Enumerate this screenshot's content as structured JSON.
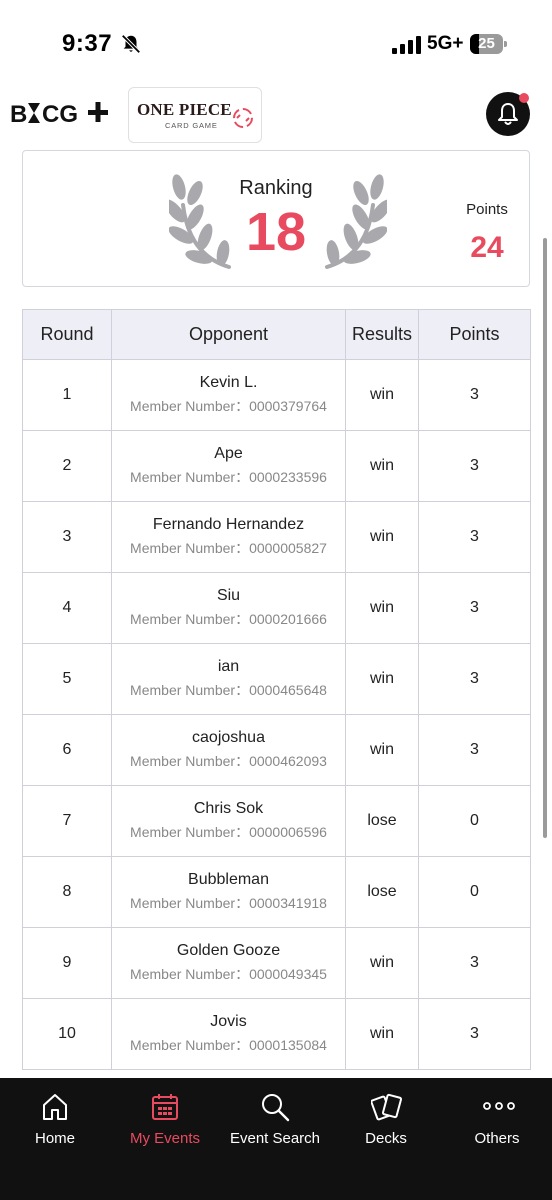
{
  "status_bar": {
    "time": "9:37",
    "network": "5G+",
    "battery": "25"
  },
  "header": {
    "brand": "BCG+",
    "game_logo_title": "ONE PIECE",
    "game_logo_subtitle": "CARD GAME"
  },
  "summary": {
    "ranking_label": "Ranking",
    "ranking_value": "18",
    "points_label": "Points",
    "points_value": "24"
  },
  "table": {
    "headers": {
      "round": "Round",
      "opponent": "Opponent",
      "results": "Results",
      "points": "Points"
    },
    "rows": [
      {
        "round": "1",
        "name": "Kevin L.",
        "member": "Member Number：0000379764",
        "result": "win",
        "points": "3"
      },
      {
        "round": "2",
        "name": "Ape",
        "member": "Member Number：0000233596",
        "result": "win",
        "points": "3"
      },
      {
        "round": "3",
        "name": "Fernando Hernandez",
        "member": "Member Number：0000005827",
        "result": "win",
        "points": "3"
      },
      {
        "round": "4",
        "name": "Siu",
        "member": "Member Number：0000201666",
        "result": "win",
        "points": "3"
      },
      {
        "round": "5",
        "name": "ian",
        "member": "Member Number：0000465648",
        "result": "win",
        "points": "3"
      },
      {
        "round": "6",
        "name": "caojoshua",
        "member": "Member Number：0000462093",
        "result": "win",
        "points": "3"
      },
      {
        "round": "7",
        "name": "Chris Sok",
        "member": "Member Number：0000006596",
        "result": "lose",
        "points": "0"
      },
      {
        "round": "8",
        "name": "Bubbleman",
        "member": "Member Number：0000341918",
        "result": "lose",
        "points": "0"
      },
      {
        "round": "9",
        "name": "Golden Gooze",
        "member": "Member Number：0000049345",
        "result": "win",
        "points": "3"
      },
      {
        "round": "10",
        "name": "Jovis",
        "member": "Member Number：0000135084",
        "result": "win",
        "points": "3"
      }
    ]
  },
  "nav": {
    "items": [
      {
        "label": "Home",
        "icon": "home-icon"
      },
      {
        "label": "My Events",
        "icon": "calendar-icon",
        "active": true
      },
      {
        "label": "Event Search",
        "icon": "search-icon"
      },
      {
        "label": "Decks",
        "icon": "cards-icon"
      },
      {
        "label": "Others",
        "icon": "more-icon"
      }
    ]
  },
  "colors": {
    "accent": "#e84a5f",
    "nav_background": "#111111",
    "header_row": "#eeeef6",
    "laurel": "#a9a9ad"
  }
}
